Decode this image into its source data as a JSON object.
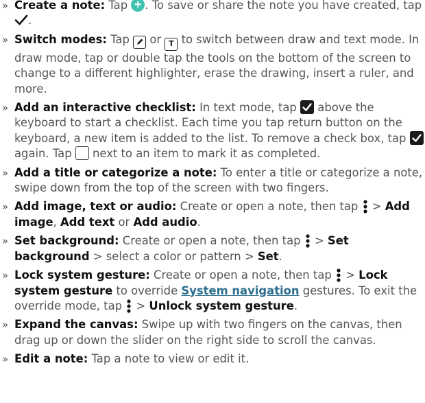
{
  "items": [
    {
      "lead": "Create a note:",
      "t1": " Tap ",
      "t2": ". To save or share the note you have created, tap ",
      "t3": "."
    },
    {
      "lead": "Switch modes:",
      "t1": " Tap ",
      "t2": " or ",
      "t3": " to switch between draw and text mode. In draw mode, tap or double tap the tools on the bottom of the screen to change to a different highlighter, erase the drawing, insert a ruler, and more."
    },
    {
      "lead": "Add an interactive checklist:",
      "t1": " In text mode, tap ",
      "t2": " above the keyboard to start a checklist. Each time you tap return button on the keyboard, a new item is added to the list. To remove a check box, tap ",
      "t3": " again. Tap ",
      "t4": " next to an item to mark it as completed."
    },
    {
      "lead": "Add a title or categorize a note:",
      "t1": " To enter a title or categorize a note, swipe down from the top of the screen with two fingers."
    },
    {
      "lead": "Add image, text or audio:",
      "t1": " Create or open a note, then tap ",
      "t2": " > ",
      "b1": "Add image",
      "t3": ", ",
      "b2": "Add text",
      "t4": " or ",
      "b3": "Add audio",
      "t5": "."
    },
    {
      "lead": "Set background:",
      "t1": " Create or open a note, then tap ",
      "t2": " > ",
      "b1": "Set background",
      "t3": " > select a color or pattern > ",
      "b2": "Set",
      "t4": "."
    },
    {
      "lead": "Lock system gesture:",
      "t1": " Create or open a note, then tap ",
      "t2": " > ",
      "b1": "Lock system gesture",
      "t3": " to override ",
      "link": "System navigation",
      "t4": " gestures. To exit the override mode, tap ",
      "t5": " > ",
      "b2": "Unlock system gesture",
      "t6": "."
    },
    {
      "lead": "Expand the canvas:",
      "t1": " Swipe up with two fingers on the canvas, then drag up or down the slider on the right side to scroll the canvas."
    },
    {
      "lead": "Edit a note:",
      "t1": " Tap a note to view or edit it."
    }
  ],
  "bullet_glyph": "»",
  "icons": {
    "add": "plus-circle-icon",
    "check": "checkmark-icon",
    "draw_mode": "pencil-box-icon",
    "text_mode_letter": "T",
    "checklist": "filled-checkbox-icon",
    "empty_box": "empty-checkbox-icon",
    "menu": "more-vert-icon"
  },
  "colors": {
    "text": "#555555",
    "bold": "#111111",
    "link": "#2e6f8e",
    "accent": "#3fc3b0"
  }
}
